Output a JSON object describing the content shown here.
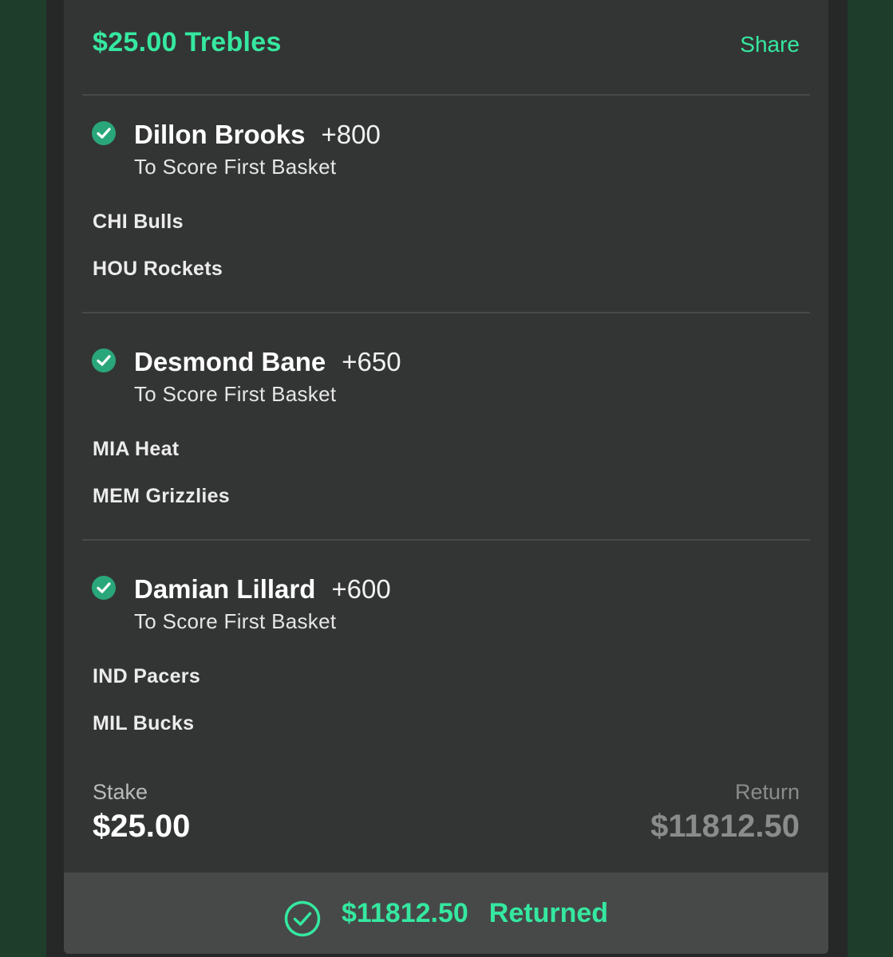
{
  "header": {
    "title": "$25.00 Trebles",
    "share_label": "Share"
  },
  "selections": [
    {
      "player": "Dillon Brooks",
      "odds": "+800",
      "market": "To Score First Basket",
      "team_1": "CHI Bulls",
      "team_2": "HOU Rockets",
      "status_icon": "check-circle-icon"
    },
    {
      "player": "Desmond Bane",
      "odds": "+650",
      "market": "To Score First Basket",
      "team_1": "MIA Heat",
      "team_2": "MEM Grizzlies",
      "status_icon": "check-circle-icon"
    },
    {
      "player": "Damian Lillard",
      "odds": "+600",
      "market": "To Score First Basket",
      "team_1": "IND Pacers",
      "team_2": "MIL Bucks",
      "status_icon": "check-circle-icon"
    }
  ],
  "summary": {
    "stake_label": "Stake",
    "stake_value": "$25.00",
    "return_label": "Return",
    "return_value": "$11812.50"
  },
  "returned": {
    "amount": "$11812.50",
    "label": "Returned",
    "icon": "check-circle-outline-icon"
  },
  "colors": {
    "accent": "#35e8a0",
    "check_fill": "#2aa77a",
    "card_background": "#333534",
    "page_background": "#1f3d2b"
  }
}
